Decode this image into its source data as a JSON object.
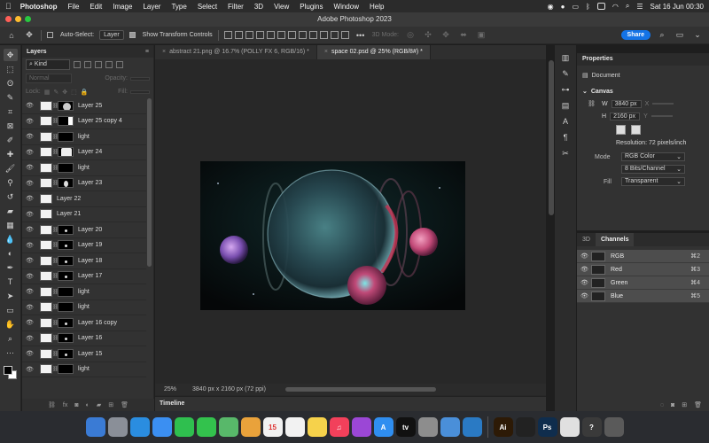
{
  "menubar": {
    "apple": "",
    "items": [
      "Photoshop",
      "File",
      "Edit",
      "Image",
      "Layer",
      "Type",
      "Select",
      "Filter",
      "3D",
      "View",
      "Plugins",
      "Window",
      "Help"
    ],
    "clock": "Sat 16 Jun  00:30"
  },
  "window": {
    "title": "Adobe Photoshop 2023"
  },
  "options": {
    "auto_select_label": "Auto-Select:",
    "auto_select_value": "Layer",
    "show_transform": "Show Transform Controls",
    "mode_3d": "3D Mode:",
    "share_label": "Share"
  },
  "layers_panel": {
    "title": "Layers",
    "kind_filter": "Kind",
    "blend_mode": "Normal",
    "opacity_label": "Opacity:",
    "lock_label": "Lock:",
    "fill_label": "Fill:",
    "layers": [
      {
        "name": "Layer 25",
        "mask": "orb"
      },
      {
        "name": "Layer 25 copy 4",
        "mask": "right"
      },
      {
        "name": "light",
        "mask": "dark"
      },
      {
        "name": "Layer 24",
        "mask": "white"
      },
      {
        "name": "light",
        "mask": "dark"
      },
      {
        "name": "Layer 23",
        "mask": "moon"
      },
      {
        "name": "Layer 22",
        "mask": "none"
      },
      {
        "name": "Layer 21",
        "mask": "none"
      },
      {
        "name": "Layer 20",
        "mask": "dot"
      },
      {
        "name": "Layer 19",
        "mask": "dot"
      },
      {
        "name": "Layer 18",
        "mask": "dot"
      },
      {
        "name": "Layer 17",
        "mask": "dot"
      },
      {
        "name": "light",
        "mask": "dark"
      },
      {
        "name": "light",
        "mask": "dark"
      },
      {
        "name": "Layer 16 copy",
        "mask": "dot"
      },
      {
        "name": "Layer 16",
        "mask": "dot"
      },
      {
        "name": "Layer 15",
        "mask": "dot"
      },
      {
        "name": "light",
        "mask": "dark"
      }
    ]
  },
  "document": {
    "tabs": [
      {
        "label": "abstract 21.png @ 16.7% (POLLY FX 6, RGB/16) *",
        "active": false
      },
      {
        "label": "space 02.psd @ 25% (RGB/8#) *",
        "active": true
      }
    ],
    "zoom": "25%",
    "dimensions": "3840 px x 2160 px (72 ppi)"
  },
  "timeline": {
    "label": "Timeline"
  },
  "properties": {
    "title": "Properties",
    "doc_label": "Document",
    "canvas_label": "Canvas",
    "width_label": "W",
    "width_value": "3840 px",
    "height_label": "H",
    "height_value": "2160 px",
    "x_label": "X",
    "y_label": "Y",
    "resolution": "Resolution: 72 pixels/inch",
    "mode_label": "Mode",
    "mode_value": "RGB Color",
    "depth_value": "8 Bits/Channel",
    "fill_label": "Fill",
    "fill_value": "Transparent"
  },
  "channels_panel": {
    "tab_3d": "3D",
    "tab_channels": "Channels",
    "channels": [
      {
        "name": "RGB",
        "shortcut": "⌘2"
      },
      {
        "name": "Red",
        "shortcut": "⌘3"
      },
      {
        "name": "Green",
        "shortcut": "⌘4"
      },
      {
        "name": "Blue",
        "shortcut": "⌘5"
      }
    ]
  },
  "dock": {
    "apps": [
      {
        "name": "finder",
        "color": "#3a7bd5",
        "glyph": ""
      },
      {
        "name": "launchpad",
        "color": "#8a8f98",
        "glyph": ""
      },
      {
        "name": "safari",
        "color": "#2a8de0",
        "glyph": ""
      },
      {
        "name": "mail",
        "color": "#3b8ff2",
        "glyph": ""
      },
      {
        "name": "facetime",
        "color": "#2fbf4f",
        "glyph": ""
      },
      {
        "name": "messages",
        "color": "#33c24d",
        "glyph": ""
      },
      {
        "name": "maps",
        "color": "#58b86a",
        "glyph": ""
      },
      {
        "name": "photos",
        "color": "#e9a23b",
        "glyph": ""
      },
      {
        "name": "calendar",
        "color": "#f2f2f2",
        "glyph": "15"
      },
      {
        "name": "reminders",
        "color": "#f2f2f2",
        "glyph": ""
      },
      {
        "name": "notes",
        "color": "#f6d24b",
        "glyph": ""
      },
      {
        "name": "music",
        "color": "#f2405b",
        "glyph": "♫"
      },
      {
        "name": "podcasts",
        "color": "#9b47d6",
        "glyph": ""
      },
      {
        "name": "app-store",
        "color": "#2f8ef0",
        "glyph": "A"
      },
      {
        "name": "tv",
        "color": "#111111",
        "glyph": "tv"
      },
      {
        "name": "system-settings",
        "color": "#8d8d8d",
        "glyph": ""
      },
      {
        "name": "preview",
        "color": "#4a8fd9",
        "glyph": ""
      },
      {
        "name": "vscode",
        "color": "#2a7ac4",
        "glyph": ""
      },
      {
        "name": "illustrator",
        "color": "#2d1a06",
        "glyph": "Ai"
      },
      {
        "name": "cinema",
        "color": "#222222",
        "glyph": ""
      },
      {
        "name": "photoshop",
        "color": "#0f2d4d",
        "glyph": "Ps"
      },
      {
        "name": "screenshot",
        "color": "#e0e0e0",
        "glyph": ""
      },
      {
        "name": "help",
        "color": "#3a3a3a",
        "glyph": "?"
      },
      {
        "name": "trash",
        "color": "#5a5a5a",
        "glyph": ""
      }
    ]
  }
}
